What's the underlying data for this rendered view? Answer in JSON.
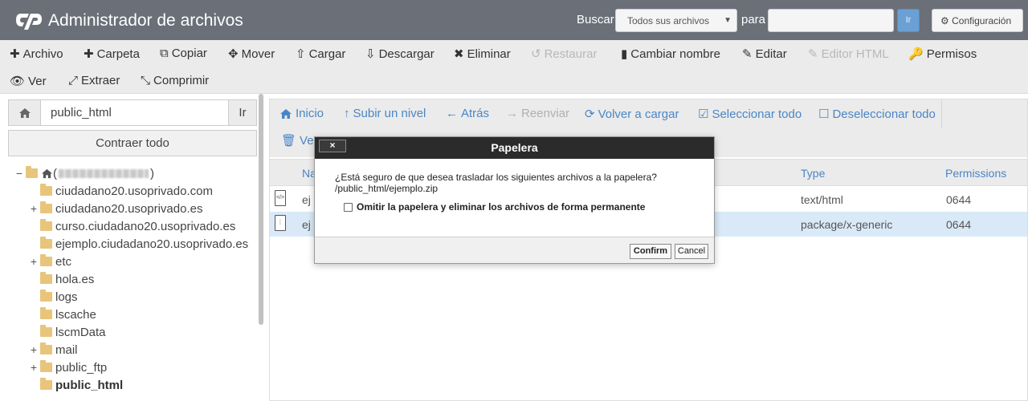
{
  "header": {
    "title": "Administrador de archivos",
    "search_label": "Buscar",
    "search_scope": "Todos sus archivos",
    "for_label": "para",
    "search_value": "",
    "go_label": "Ir",
    "config_label": "Configuración"
  },
  "toolbar": {
    "row1": [
      {
        "label": "Archivo",
        "icon": "plus-icon",
        "enabled": true
      },
      {
        "label": "Carpeta",
        "icon": "plus-icon",
        "enabled": true
      },
      {
        "label": "Copiar",
        "icon": "copy-icon",
        "enabled": true
      },
      {
        "label": "Mover",
        "icon": "move-icon",
        "enabled": true
      },
      {
        "label": "Cargar",
        "icon": "upload-icon",
        "enabled": true
      },
      {
        "label": "Descargar",
        "icon": "download-icon",
        "enabled": true
      },
      {
        "label": "Eliminar",
        "icon": "times-icon",
        "enabled": true
      },
      {
        "label": "Restaurar",
        "icon": "undo-icon",
        "enabled": false
      },
      {
        "label": "Cambiar nombre",
        "icon": "file-icon",
        "enabled": true
      },
      {
        "label": "Editar",
        "icon": "pencil-icon",
        "enabled": true
      },
      {
        "label": "Editor HTML",
        "icon": "edit-icon",
        "enabled": false
      },
      {
        "label": "Permisos",
        "icon": "key-icon",
        "enabled": true
      }
    ],
    "row2": [
      {
        "label": "Ver",
        "icon": "eye-icon",
        "enabled": true
      },
      {
        "label": "Extraer",
        "icon": "expand-icon",
        "enabled": true
      },
      {
        "label": "Comprimir",
        "icon": "compress-icon",
        "enabled": true
      }
    ]
  },
  "left": {
    "path_value": "public_html",
    "path_go": "Ir",
    "collapse_label": "Contraer todo",
    "tree": [
      {
        "label": "ciudadano20.usoprivado.com",
        "toggle": ""
      },
      {
        "label": "ciudadano20.usoprivado.es",
        "toggle": "+"
      },
      {
        "label": "curso.ciudadano20.usoprivado.es",
        "toggle": ""
      },
      {
        "label": "ejemplo.ciudadano20.usoprivado.es",
        "toggle": ""
      },
      {
        "label": "etc",
        "toggle": "+"
      },
      {
        "label": "hola.es",
        "toggle": ""
      },
      {
        "label": "logs",
        "toggle": ""
      },
      {
        "label": "lscache",
        "toggle": ""
      },
      {
        "label": "lscmData",
        "toggle": ""
      },
      {
        "label": "mail",
        "toggle": "+"
      },
      {
        "label": "public_ftp",
        "toggle": "+"
      },
      {
        "label": "public_html",
        "toggle": ""
      }
    ]
  },
  "nav": {
    "items": [
      {
        "label": "Inicio",
        "icon": "home-icon",
        "enabled": true
      },
      {
        "label": "Subir un nivel",
        "icon": "arrow-up-icon",
        "enabled": true
      },
      {
        "label": "Atrás",
        "icon": "arrow-left-icon",
        "enabled": true
      },
      {
        "label": "Reenviar",
        "icon": "arrow-right-icon",
        "enabled": false
      },
      {
        "label": "Volver a cargar",
        "icon": "refresh-icon",
        "enabled": true
      },
      {
        "label": "Seleccionar todo",
        "icon": "checkbox-checked-icon",
        "enabled": true
      },
      {
        "label": "Deseleccionar todo",
        "icon": "checkbox-icon",
        "enabled": true
      }
    ],
    "row2_visible": "Ver"
  },
  "table": {
    "headers": {
      "name": "Na",
      "type": "Type",
      "permissions": "Permissions"
    },
    "rows": [
      {
        "name": "ej",
        "type": "text/html",
        "perms": "0644",
        "icon": "code-file-icon"
      },
      {
        "name": "ej",
        "type": "package/x-generic",
        "perms": "0644",
        "icon": "zip-file-icon"
      }
    ]
  },
  "dialog": {
    "title": "Papelera",
    "close": "×",
    "question": "¿Está seguro de que desea trasladar los siguientes archivos a la papelera?",
    "file": "/public_html/ejemplo.zip",
    "omit_label": "Omitir la papelera y eliminar los archivos de forma permanente",
    "confirm_label": "Confirm",
    "cancel_label": "Cancel"
  }
}
